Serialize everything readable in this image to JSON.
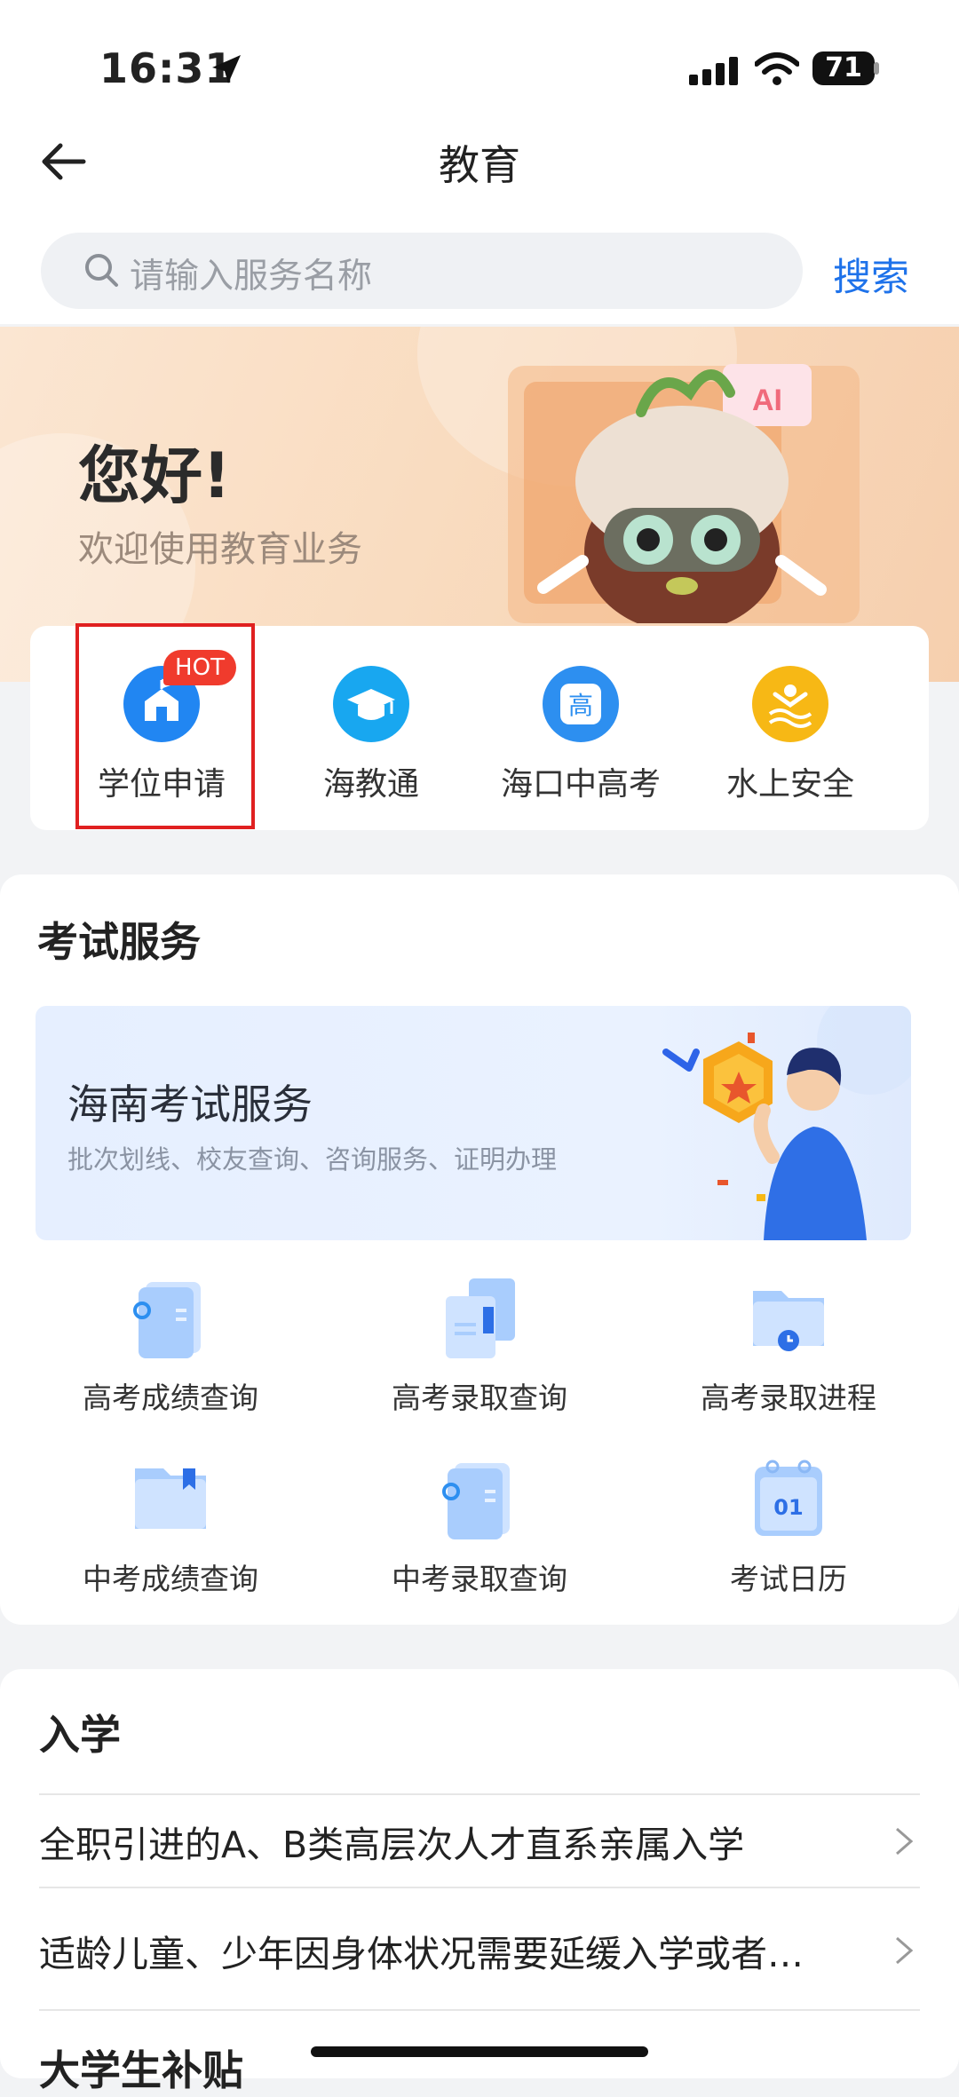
{
  "status_bar": {
    "time": "16:31",
    "battery": "71"
  },
  "header": {
    "title": "教育",
    "search_placeholder": "请输入服务名称",
    "search_button": "搜索"
  },
  "banner": {
    "greeting": "您好!",
    "welcome": "欢迎使用教育业务",
    "illustration_text": "AI"
  },
  "quick_services": [
    {
      "label": "学位申请",
      "badge": "HOT",
      "icon": "school-icon"
    },
    {
      "label": "海教通",
      "icon": "graduation-cap-icon"
    },
    {
      "label": "海口中高考",
      "icon": "gao-icon",
      "icon_char": "高"
    },
    {
      "label": "水上安全",
      "icon": "swimmer-icon"
    }
  ],
  "exam_section": {
    "title": "考试服务",
    "banner_title": "海南考试服务",
    "banner_subtitle": "批次划线、校友查询、咨询服务、证明办理",
    "items": [
      {
        "label": "高考成绩查询",
        "icon": "document-link-icon"
      },
      {
        "label": "高考录取查询",
        "icon": "documents-icon"
      },
      {
        "label": "高考录取进程",
        "icon": "folder-clock-icon"
      },
      {
        "label": "中考成绩查询",
        "icon": "folder-bookmark-icon"
      },
      {
        "label": "中考录取查询",
        "icon": "document-link-icon"
      },
      {
        "label": "考试日历",
        "icon": "calendar-icon",
        "icon_text": "01"
      }
    ]
  },
  "admission_section": {
    "title": "入学",
    "items": [
      "全职引进的A、B类高层次人才直系亲属入学",
      "适龄儿童、少年因身体状况需要延缓入学或者…"
    ],
    "next_title_partial": "大学生补贴"
  },
  "colors": {
    "accent": "#1e72ea",
    "hot": "#f03b2d",
    "highlight_box": "#e02020"
  }
}
